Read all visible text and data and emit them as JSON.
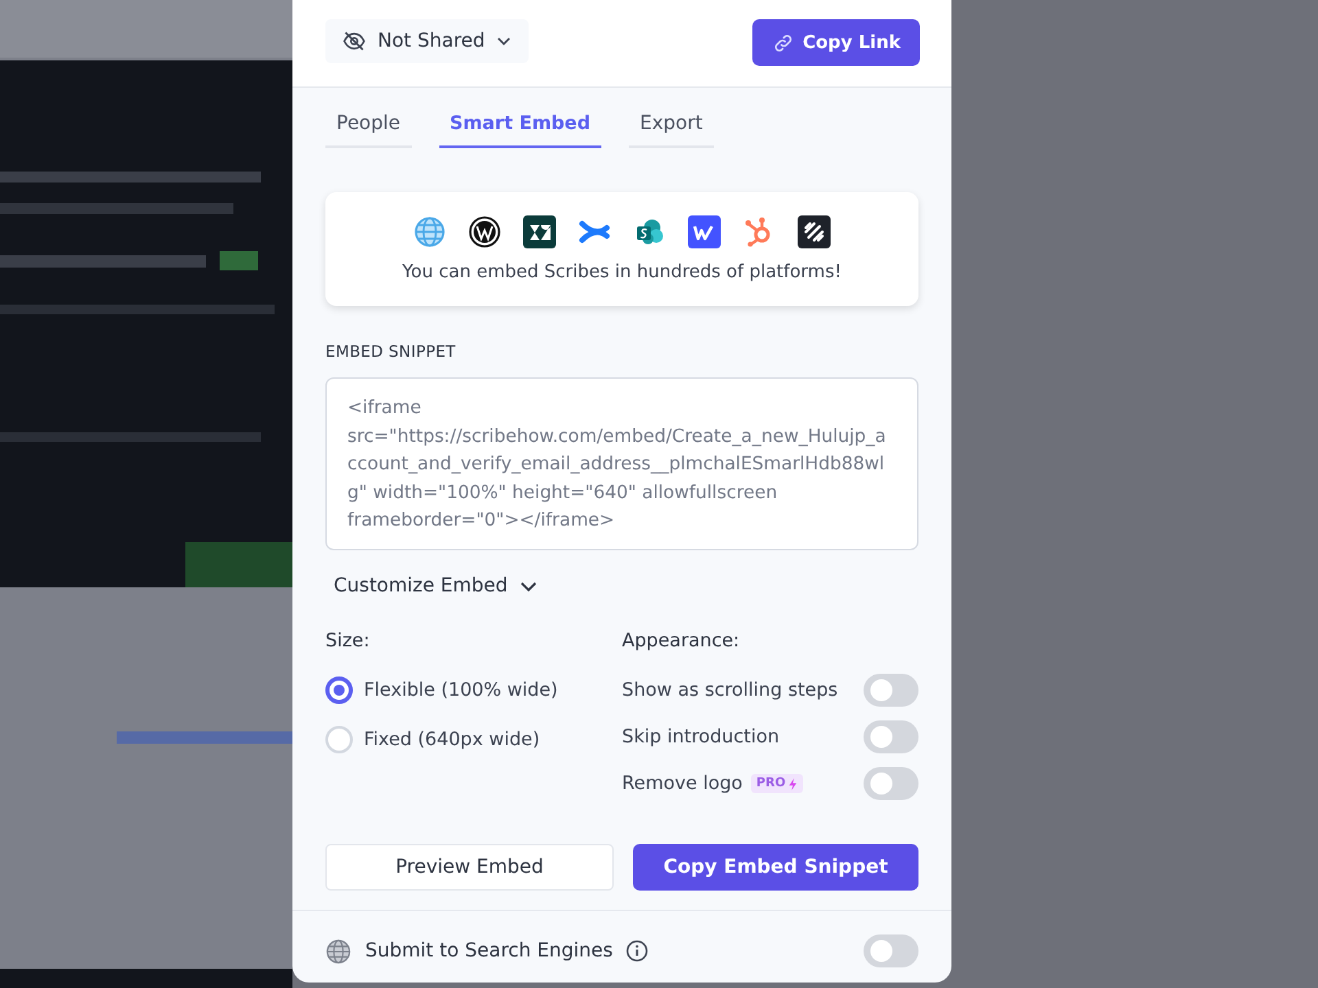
{
  "share": {
    "visibility": "Not Shared",
    "copy_button": "Copy Link"
  },
  "tabs": [
    {
      "label": "People",
      "selected": false
    },
    {
      "label": "Smart Embed",
      "selected": true
    },
    {
      "label": "Export",
      "selected": false
    }
  ],
  "platforms": {
    "caption": "You can embed Scribes in hundreds of platforms!"
  },
  "snippet": {
    "label": "EMBED SNIPPET",
    "value": "<iframe src=\"https://scribehow.com/embed/Create_a_new_Hulujp_account_and_verify_email_address__plmchalESmarlHdb88wlg\" width=\"100%\" height=\"640\" allowfullscreen frameborder=\"0\"></iframe>"
  },
  "customize": {
    "label": "Customize Embed",
    "expanded": true
  },
  "size": {
    "label": "Size:",
    "options": [
      {
        "label": "Flexible (100% wide)",
        "selected": true
      },
      {
        "label": "Fixed (640px wide)",
        "selected": false
      }
    ]
  },
  "appearance": {
    "label": "Appearance:",
    "options": [
      {
        "label": "Show as scrolling steps",
        "on": false
      },
      {
        "label": "Skip introduction",
        "on": false
      },
      {
        "label": "Remove logo",
        "badge": "PRO",
        "on": false
      }
    ]
  },
  "buttons": {
    "preview": "Preview Embed",
    "copy": "Copy Embed Snippet"
  },
  "search_engines": {
    "label": "Submit to Search Engines",
    "on": false
  }
}
